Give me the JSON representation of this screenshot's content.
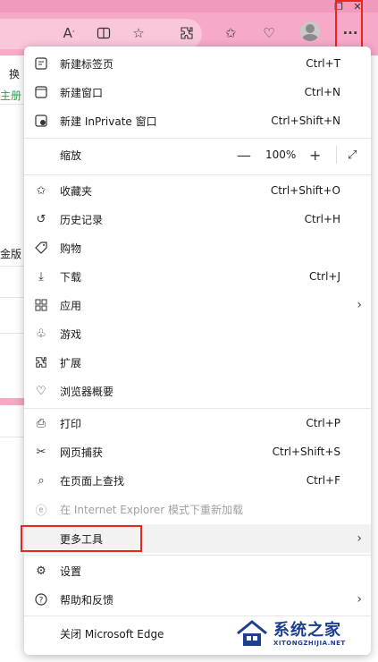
{
  "toolbar": {
    "icons": [
      "read-aloud-icon",
      "split-screen-icon",
      "favorite-star-icon",
      "extensions-icon",
      "favorites-icon",
      "browser-essentials-icon",
      "profile-avatar",
      "more-options-icon"
    ],
    "more_label": "···"
  },
  "background": {
    "fragments": [
      "换",
      "主册",
      "金版"
    ]
  },
  "menu": {
    "items": [
      {
        "id": "new-tab",
        "label": "新建标签页",
        "shortcut": "Ctrl+T",
        "icon": "new-tab-icon"
      },
      {
        "id": "new-window",
        "label": "新建窗口",
        "shortcut": "Ctrl+N",
        "icon": "new-window-icon"
      },
      {
        "id": "new-inprivate",
        "label": "新建 InPrivate 窗口",
        "shortcut": "Ctrl+Shift+N",
        "icon": "inprivate-icon"
      },
      {
        "id": "zoom",
        "label": "缩放",
        "value": "100%",
        "minus": "—",
        "plus": "+"
      },
      {
        "id": "favorites",
        "label": "收藏夹",
        "shortcut": "Ctrl+Shift+O",
        "icon": "favorites-icon"
      },
      {
        "id": "history",
        "label": "历史记录",
        "shortcut": "Ctrl+H",
        "icon": "history-icon"
      },
      {
        "id": "shopping",
        "label": "购物",
        "icon": "shopping-tag-icon"
      },
      {
        "id": "downloads",
        "label": "下载",
        "shortcut": "Ctrl+J",
        "icon": "download-icon"
      },
      {
        "id": "apps",
        "label": "应用",
        "icon": "apps-icon",
        "submenu": true
      },
      {
        "id": "games",
        "label": "游戏",
        "icon": "games-icon"
      },
      {
        "id": "extensions",
        "label": "扩展",
        "icon": "extensions-icon"
      },
      {
        "id": "essentials",
        "label": "浏览器概要",
        "icon": "heartbeat-icon"
      },
      {
        "id": "print",
        "label": "打印",
        "shortcut": "Ctrl+P",
        "icon": "print-icon"
      },
      {
        "id": "web-capture",
        "label": "网页捕获",
        "shortcut": "Ctrl+Shift+S",
        "icon": "web-capture-icon"
      },
      {
        "id": "find",
        "label": "在页面上查找",
        "shortcut": "Ctrl+F",
        "icon": "find-icon"
      },
      {
        "id": "ie-mode",
        "label": "在 Internet Explorer 模式下重新加载",
        "icon": "ie-icon",
        "disabled": true
      },
      {
        "id": "more-tools",
        "label": "更多工具",
        "submenu": true
      },
      {
        "id": "settings",
        "label": "设置",
        "icon": "settings-icon"
      },
      {
        "id": "help",
        "label": "帮助和反馈",
        "icon": "help-icon",
        "submenu": true
      },
      {
        "id": "close-edge",
        "label": "关闭 Microsoft Edge"
      }
    ]
  },
  "watermark": {
    "title": "系统之家",
    "url": "XITONGZHIJIA.NET"
  },
  "colors": {
    "toolbar": "#f6aac8",
    "highlight": "#e8271e",
    "watermark": "#1d3f8f"
  }
}
